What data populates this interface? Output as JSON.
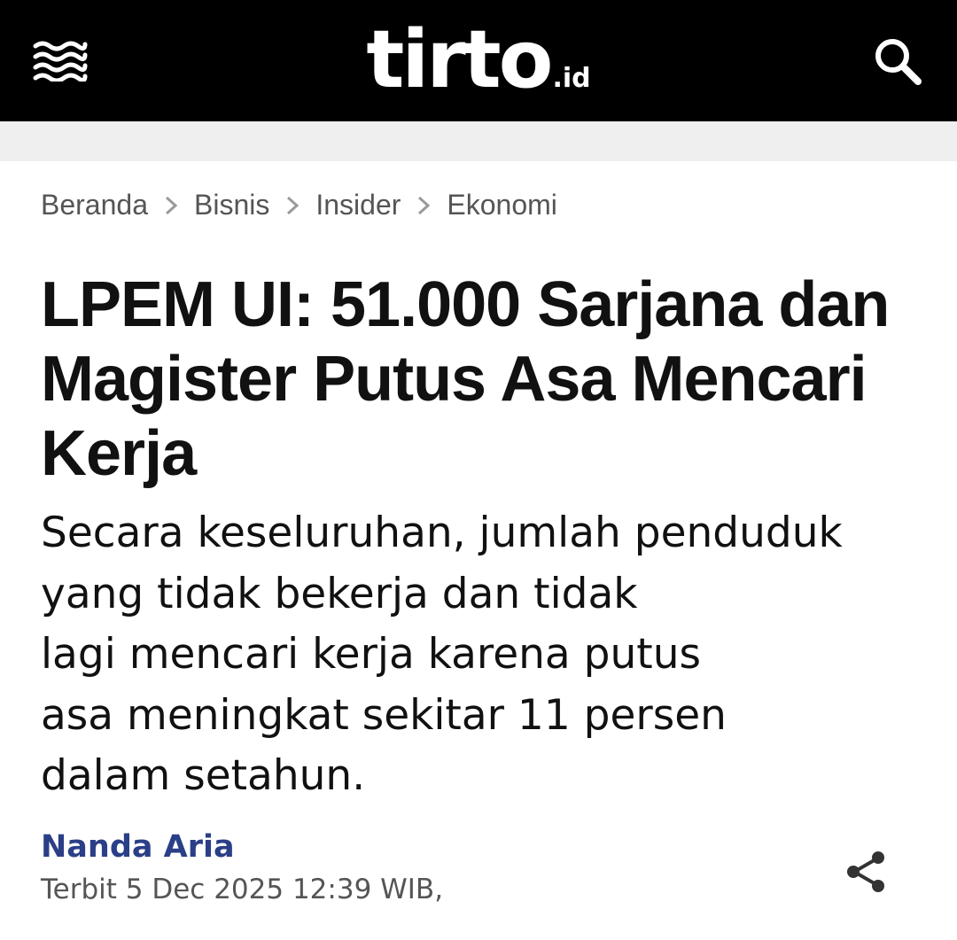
{
  "header": {
    "menu_icon": "menu-wave-icon",
    "logo_main": "tirto",
    "logo_suffix": ".id",
    "search_icon": "search-icon"
  },
  "breadcrumb": [
    {
      "label": "Beranda"
    },
    {
      "label": "Bisnis"
    },
    {
      "label": "Insider"
    },
    {
      "label": "Ekonomi"
    }
  ],
  "article": {
    "title": "LPEM UI: 51.000 Sarjana dan Magister Putus Asa Mencari Kerja",
    "lede_lines": [
      "Secara keseluruhan, jumlah penduduk",
      "yang tidak bekerja dan tidak",
      "lagi mencari kerja karena putus",
      "asa meningkat sekitar 11 persen",
      "dalam setahun."
    ],
    "author": "Nanda Aria",
    "published": "Terbit 5 Dec 2025 12:39 WIB,",
    "share_icon": "share-icon"
  },
  "colors": {
    "header_bg": "#000000",
    "band_bg": "#efefef",
    "author_link": "#2a3f87",
    "text": "#111111",
    "muted": "#555555"
  }
}
